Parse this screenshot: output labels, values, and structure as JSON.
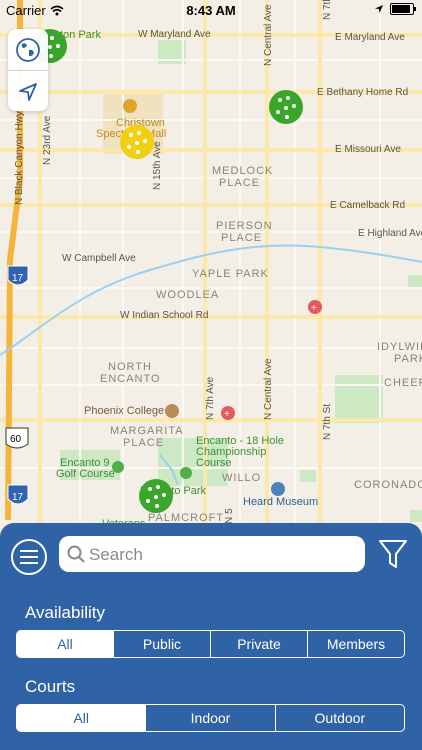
{
  "status_bar": {
    "carrier": "Carrier",
    "time": "8:43 AM"
  },
  "map": {
    "labels": {
      "eastons_park": "ton Park",
      "w_maryland": "W Maryland Ave",
      "e_maryland": "E Maryland Ave",
      "e_bethany": "E Bethany Home Rd",
      "christown": "Christown",
      "spectrum": "Spectrum Mall",
      "e_missouri": "E Missouri Ave",
      "medlock1": "MEDLOCK",
      "medlock2": "PLACE",
      "e_camelback": "E Camelback Rd",
      "pierson1": "PIERSON",
      "pierson2": "PLACE",
      "e_highland": "E Highland Ave",
      "w_campbell": "W Campbell Ave",
      "yaple": "YAPLE PARK",
      "woodlea": "WOODLEA",
      "w_indian": "W Indian School Rd",
      "idylwild1": "IDYLWIL",
      "idylwild2": "PARK",
      "north1": "NORTH",
      "north2": "ENCANTO",
      "cheer": "CHEER",
      "phoenix_college": "Phoenix College",
      "margarita1": "MARGARITA",
      "margarita2": "PLACE",
      "encanto18a": "Encanto - 18 Hole",
      "encanto18b": "Championship",
      "encanto18c": "Course",
      "encanto9a": "Encanto 9",
      "encanto9b": "Golf Course",
      "willo": "WILLO",
      "coronado": "CORONADO",
      "heard": "Heard Museum",
      "encanto_park": "Encanto Park",
      "palmcroft": "PALMCROFT",
      "veterans": "Veterans",
      "black_canyon": "N Black Canyon Hwy",
      "n23": "N 23rd Ave",
      "n15": "N 15th Ave",
      "n7": "N 7th Ave",
      "ncentral": "N Central Ave",
      "n7th_st": "N 7th St",
      "n5": "N 5",
      "i17a": "17",
      "i17b": "17",
      "us60": "60"
    }
  },
  "search": {
    "placeholder": "Search"
  },
  "availability": {
    "label": "Availability",
    "options": [
      "All",
      "Public",
      "Private",
      "Members"
    ],
    "selected": "All"
  },
  "courts": {
    "label": "Courts",
    "options": [
      "All",
      "Indoor",
      "Outdoor"
    ],
    "selected": "All"
  },
  "colors": {
    "sheet": "#2f63a6",
    "public_marker": "#3aa52a",
    "private_marker": "#f0d012"
  },
  "icons": [
    "globe-icon",
    "location-arrow-icon",
    "menu-icon",
    "search-icon",
    "filter-icon",
    "pickleball-icon"
  ]
}
